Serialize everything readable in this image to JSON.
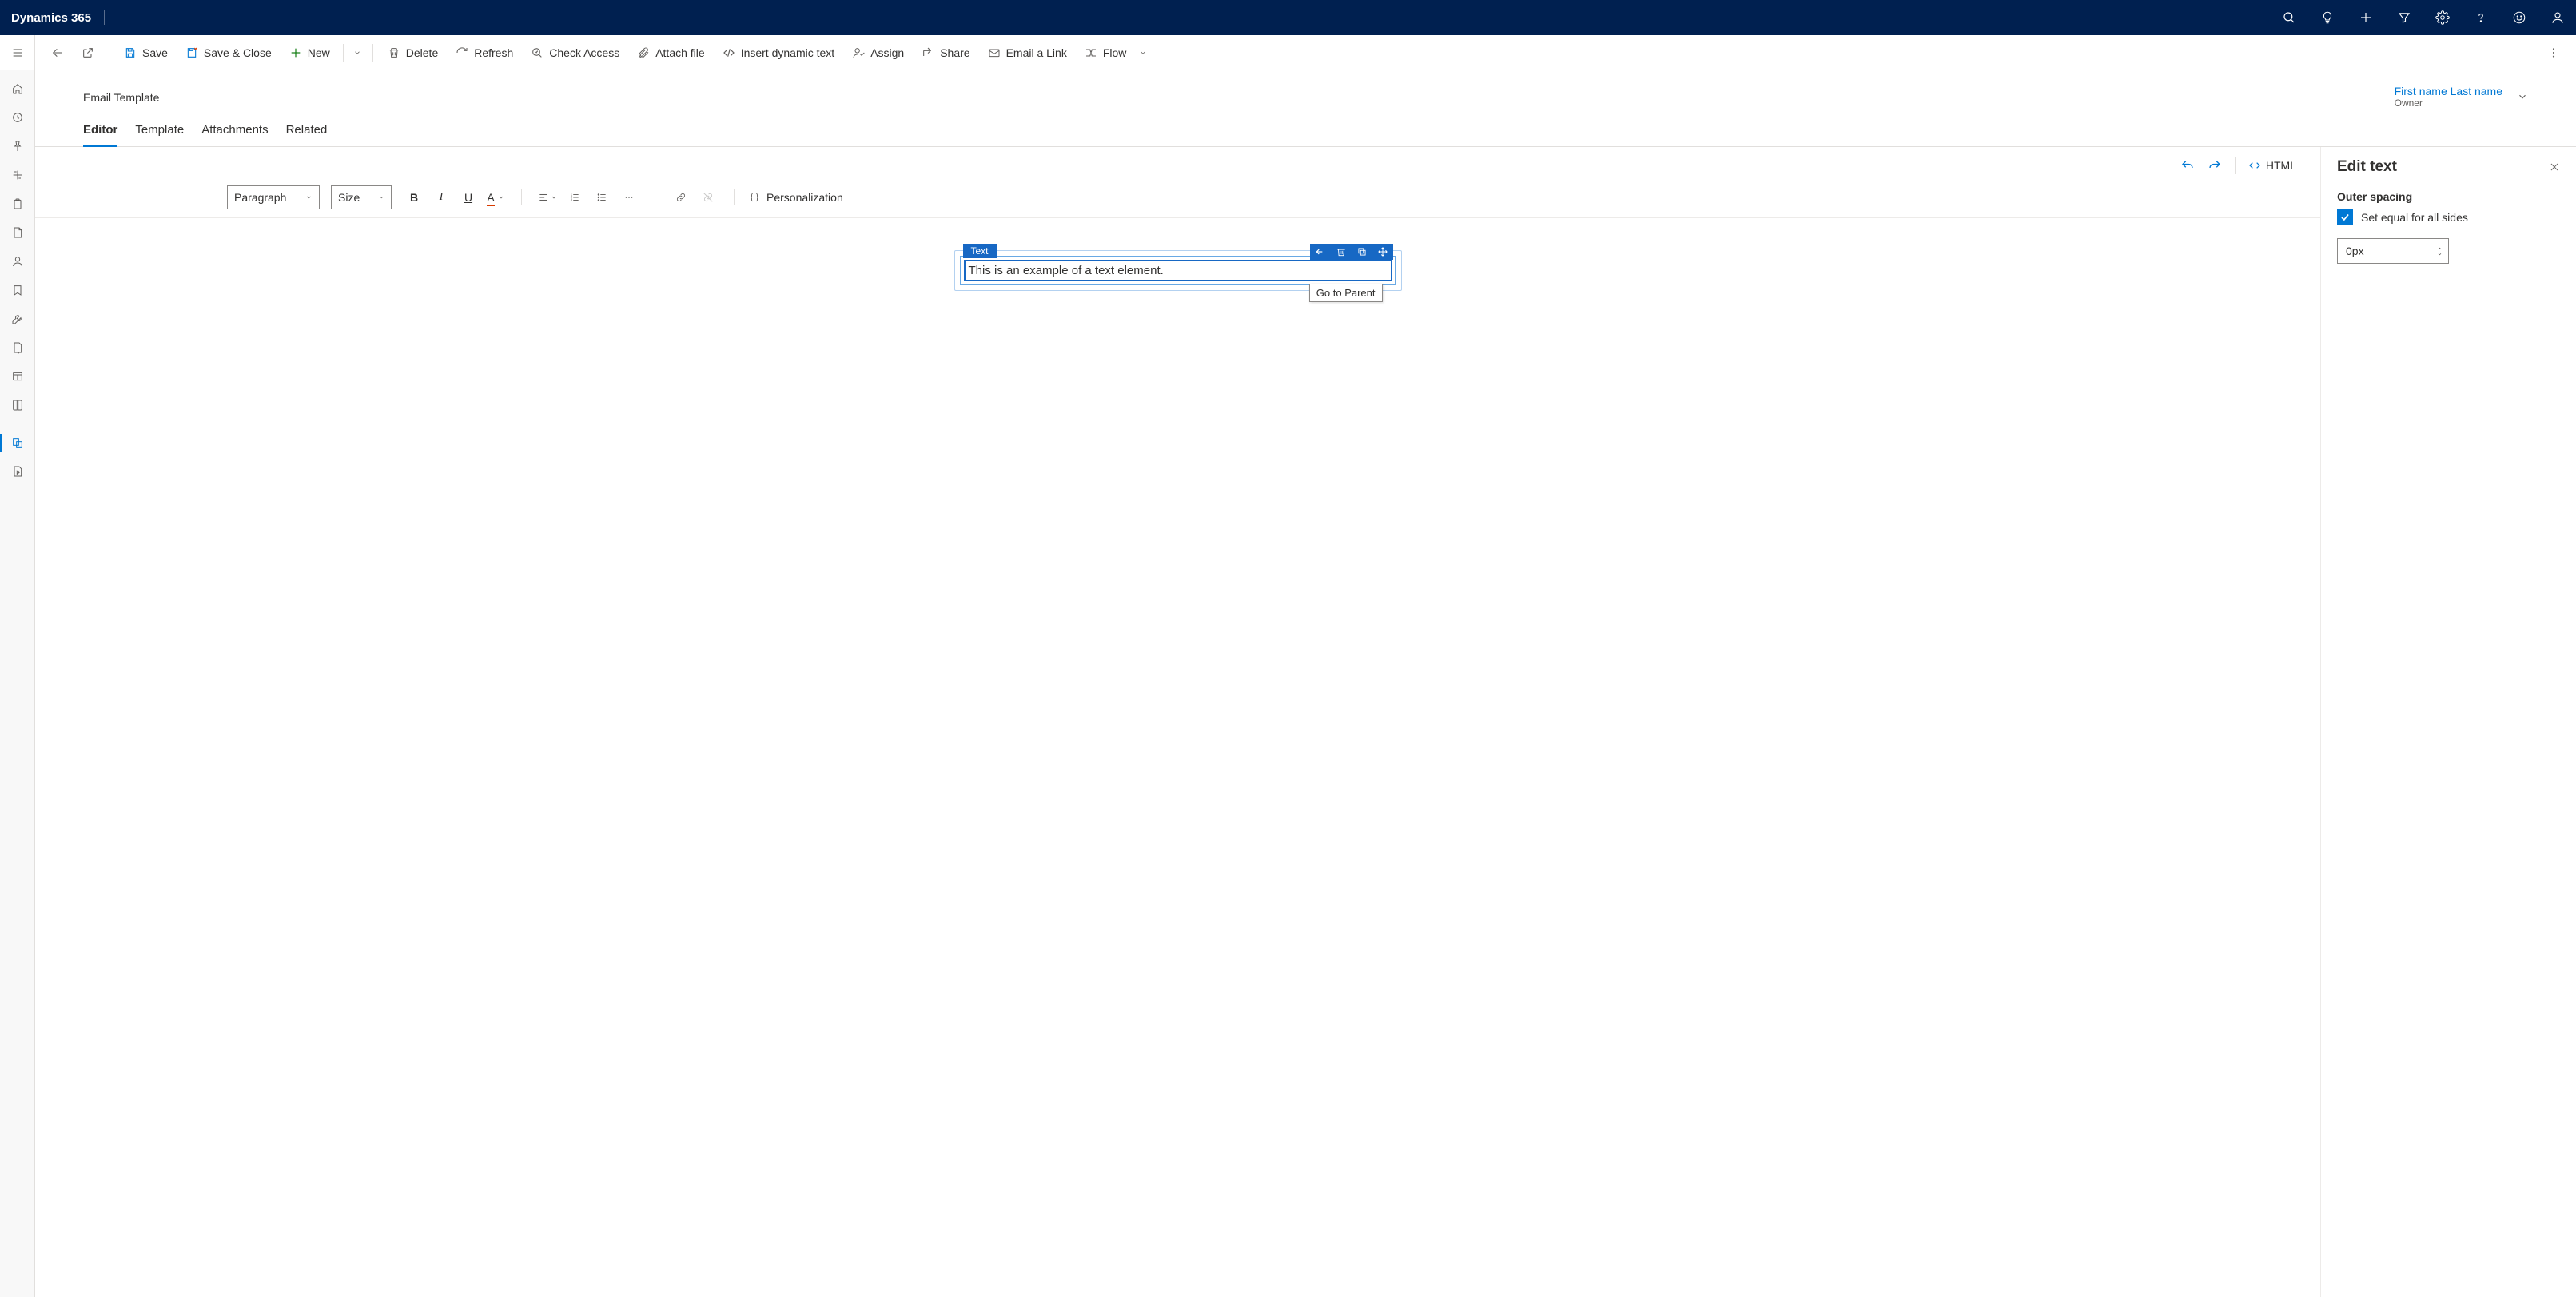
{
  "app_title": "Dynamics 365",
  "commands": {
    "save": "Save",
    "save_close": "Save & Close",
    "new": "New",
    "delete": "Delete",
    "refresh": "Refresh",
    "check_access": "Check Access",
    "attach_file": "Attach file",
    "insert_dynamic": "Insert dynamic text",
    "assign": "Assign",
    "share": "Share",
    "email_link": "Email a Link",
    "flow": "Flow"
  },
  "record": {
    "entity": "Email Template",
    "owner_name": "First name Last name",
    "owner_label": "Owner"
  },
  "tabs": [
    "Editor",
    "Template",
    "Attachments",
    "Related"
  ],
  "active_tab": 0,
  "editor": {
    "html_btn": "HTML",
    "paragraph_dd": "Paragraph",
    "size_dd": "Size",
    "personalization": "Personalization",
    "text_content": "This is an example of a text element.",
    "text_label": "Text",
    "tooltip": "Go to Parent"
  },
  "right_panel": {
    "title": "Edit text",
    "section": "Outer spacing",
    "checkbox_label": "Set equal for all sides",
    "spacing_value": "0px"
  }
}
